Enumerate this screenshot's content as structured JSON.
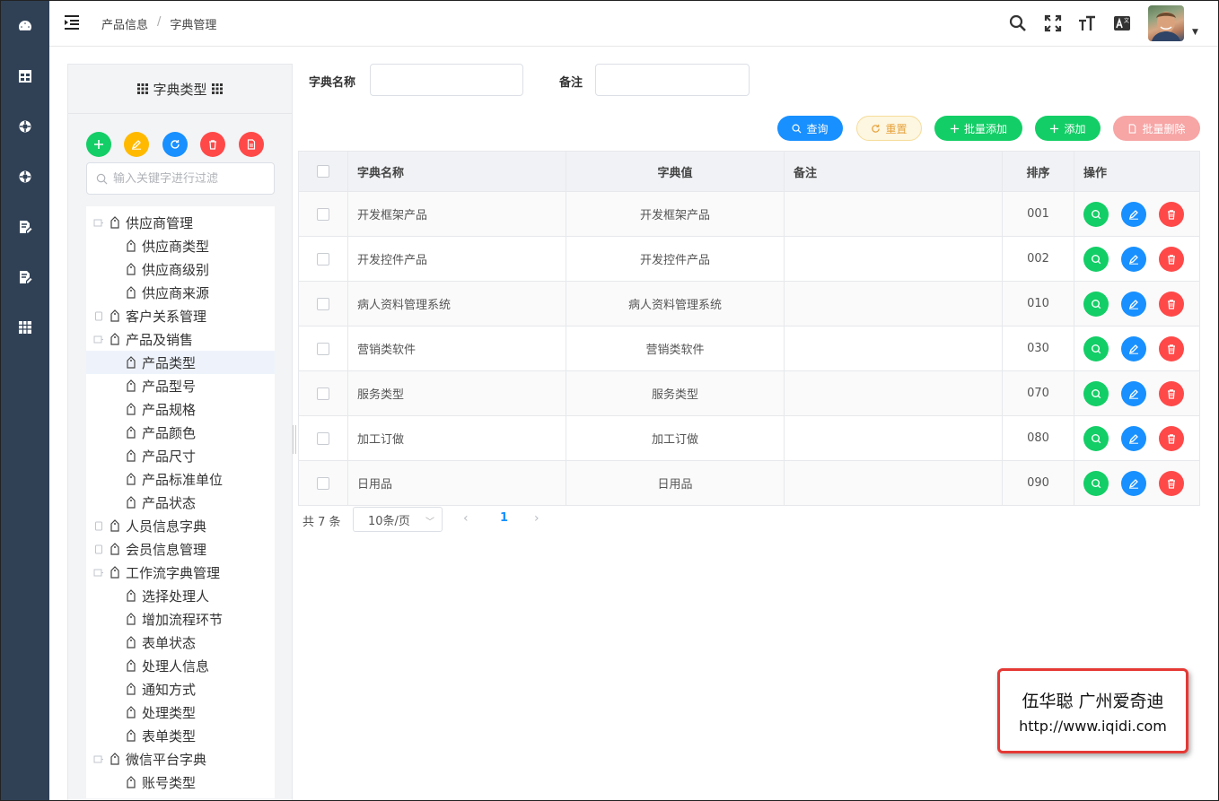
{
  "colors": {
    "sidebar_bg": "#304156",
    "green": "#13ce66",
    "orange": "#ffba00",
    "blue": "#1890ff",
    "red": "#ff4949",
    "light_red": "#f7a5a5",
    "warning_bg": "#fdf6e0"
  },
  "sidebar": {
    "icons": [
      "dashboard-icon",
      "table-icon",
      "lifebuoy-icon",
      "lifebuoy-icon",
      "document-edit-icon",
      "document-edit-icon",
      "grid-icon"
    ]
  },
  "header": {
    "breadcrumb": [
      "产品信息",
      "字典管理"
    ],
    "icons": [
      "search-icon",
      "fullscreen-icon",
      "font-size-icon",
      "translate-icon"
    ]
  },
  "tree": {
    "title": "字典类型",
    "filter_placeholder": "输入关键字进行过滤",
    "toolbar": [
      "add-icon",
      "edit-icon",
      "refresh-icon",
      "delete-icon",
      "export-icon"
    ],
    "nodes": [
      {
        "label": "供应商管理",
        "level": 0,
        "expanded": true
      },
      {
        "label": "供应商类型",
        "level": 1
      },
      {
        "label": "供应商级别",
        "level": 1
      },
      {
        "label": "供应商来源",
        "level": 1
      },
      {
        "label": "客户关系管理",
        "level": 0,
        "expanded": false
      },
      {
        "label": "产品及销售",
        "level": 0,
        "expanded": true
      },
      {
        "label": "产品类型",
        "level": 1,
        "selected": true
      },
      {
        "label": "产品型号",
        "level": 1
      },
      {
        "label": "产品规格",
        "level": 1
      },
      {
        "label": "产品颜色",
        "level": 1
      },
      {
        "label": "产品尺寸",
        "level": 1
      },
      {
        "label": "产品标准单位",
        "level": 1
      },
      {
        "label": "产品状态",
        "level": 1
      },
      {
        "label": "人员信息字典",
        "level": 0,
        "expanded": false
      },
      {
        "label": "会员信息管理",
        "level": 0,
        "expanded": false
      },
      {
        "label": "工作流字典管理",
        "level": 0,
        "expanded": true
      },
      {
        "label": "选择处理人",
        "level": 1
      },
      {
        "label": "增加流程环节",
        "level": 1
      },
      {
        "label": "表单状态",
        "level": 1
      },
      {
        "label": "处理人信息",
        "level": 1
      },
      {
        "label": "通知方式",
        "level": 1
      },
      {
        "label": "处理类型",
        "level": 1
      },
      {
        "label": "表单类型",
        "level": 1
      },
      {
        "label": "微信平台字典",
        "level": 0,
        "expanded": true
      },
      {
        "label": "账号类型",
        "level": 1
      }
    ]
  },
  "search": {
    "name_label": "字典名称",
    "name_value": "",
    "remark_label": "备注",
    "remark_value": ""
  },
  "actions": {
    "query": "查询",
    "reset": "重置",
    "batch_add": "批量添加",
    "add": "添加",
    "batch_delete": "批量删除"
  },
  "table": {
    "columns": [
      "字典名称",
      "字典值",
      "备注",
      "排序",
      "操作"
    ],
    "rows": [
      {
        "name": "开发框架产品",
        "value": "开发框架产品",
        "remark": "",
        "order": "001"
      },
      {
        "name": "开发控件产品",
        "value": "开发控件产品",
        "remark": "",
        "order": "002"
      },
      {
        "name": "病人资料管理系统",
        "value": "病人资料管理系统",
        "remark": "",
        "order": "010"
      },
      {
        "name": "营销类软件",
        "value": "营销类软件",
        "remark": "",
        "order": "030"
      },
      {
        "name": "服务类型",
        "value": "服务类型",
        "remark": "",
        "order": "070"
      },
      {
        "name": "加工订做",
        "value": "加工订做",
        "remark": "",
        "order": "080"
      },
      {
        "name": "日用品",
        "value": "日用品",
        "remark": "",
        "order": "090"
      }
    ]
  },
  "pagination": {
    "total_text": "共 7 条",
    "page_size": "10条/页",
    "current_page": "1"
  },
  "watermark": {
    "line1": "伍华聪 广州爱奇迪",
    "line2": "http://www.iqidi.com"
  }
}
